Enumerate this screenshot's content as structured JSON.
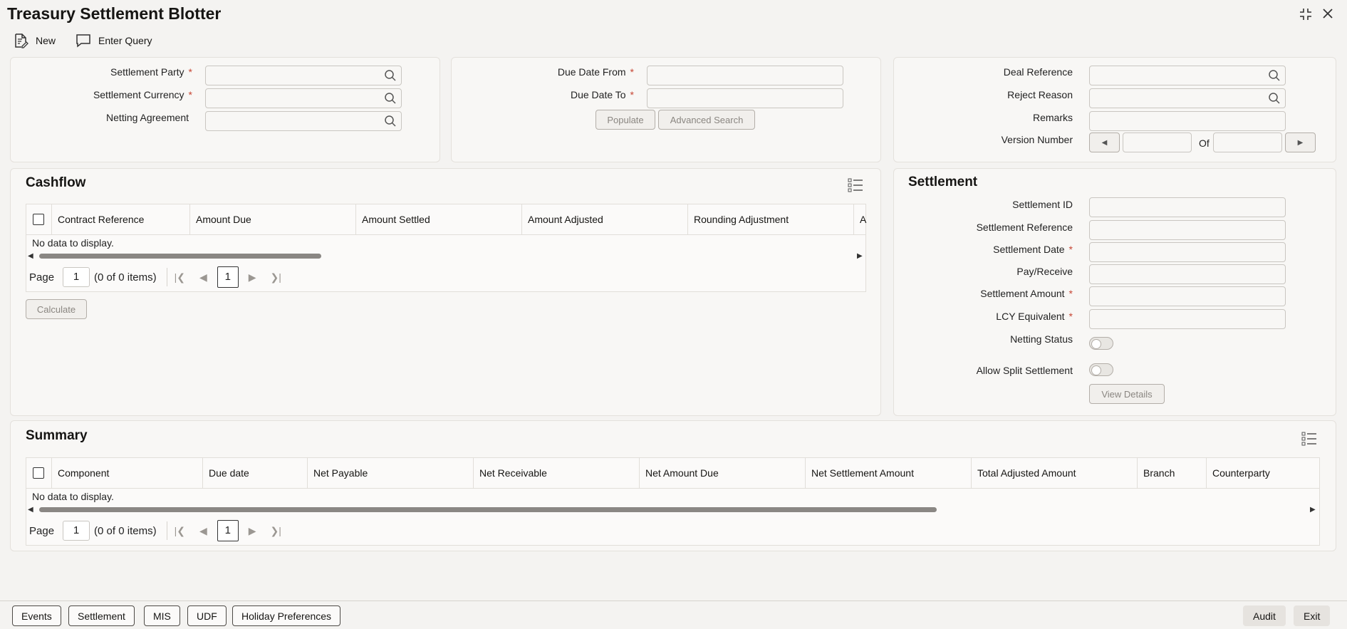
{
  "window": {
    "title": "Treasury Settlement Blotter"
  },
  "toolbar": {
    "new_label": "New",
    "enter_query_label": "Enter Query"
  },
  "filters": {
    "settlement_party": "Settlement Party",
    "settlement_currency": "Settlement Currency",
    "netting_agreement": "Netting Agreement",
    "due_date_from": "Due Date From",
    "due_date_to": "Due Date To",
    "populate": "Populate",
    "advanced_search": "Advanced Search",
    "deal_reference": "Deal Reference",
    "reject_reason": "Reject Reason",
    "remarks": "Remarks",
    "version_number": "Version Number",
    "of": "Of"
  },
  "required_mark": "*",
  "cashflow": {
    "title": "Cashflow",
    "columns": [
      "Contract Reference",
      "Amount Due",
      "Amount Settled",
      "Amount Adjusted",
      "Rounding Adjustment",
      "A"
    ],
    "no_data": "No data to display.",
    "pager": {
      "page_label": "Page",
      "page_value": "1",
      "items": "(0 of 0 items)",
      "current": "1"
    },
    "calculate": "Calculate"
  },
  "settlement": {
    "title": "Settlement",
    "settlement_id": "Settlement ID",
    "settlement_reference": "Settlement Reference",
    "settlement_date": "Settlement Date",
    "pay_receive": "Pay/Receive",
    "settlement_amount": "Settlement Amount",
    "lcy_equivalent": "LCY Equivalent",
    "netting_status": "Netting Status",
    "allow_split": "Allow Split Settlement",
    "view_details": "View Details"
  },
  "summary": {
    "title": "Summary",
    "columns": [
      "Component",
      "Due date",
      "Net Payable",
      "Net Receivable",
      "Net Amount Due",
      "Net Settlement Amount",
      "Total Adjusted Amount",
      "Branch",
      "Counterparty"
    ],
    "no_data": "No data to display.",
    "pager": {
      "page_label": "Page",
      "page_value": "1",
      "items": "(0 of 0 items)",
      "current": "1"
    }
  },
  "footer": {
    "events": "Events",
    "settlement": "Settlement",
    "mis": "MIS",
    "udf": "UDF",
    "holiday_preferences": "Holiday Preferences",
    "audit": "Audit",
    "exit": "Exit"
  }
}
